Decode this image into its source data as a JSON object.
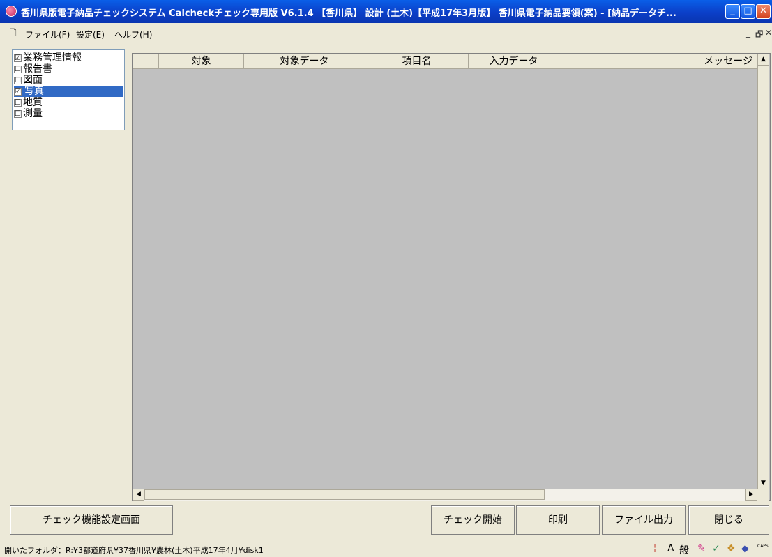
{
  "window": {
    "title": "香川県版電子納品チェックシステム Calcheckチェック専用版 V6.1.4 【香川県】 設計 (土木)【平成17年3月版】 香川県電子納品要領(案) - [納品データチ..."
  },
  "window_controls": {
    "minimize": "_",
    "maximize": "□",
    "close": "✕"
  },
  "menu": {
    "items": [
      "ファイル(F)",
      "設定(E)",
      "ヘルプ(H)"
    ]
  },
  "mdi_controls": {
    "minimize": "_",
    "restore": "🗗",
    "close": "✕"
  },
  "tree": {
    "items": [
      {
        "label": "業務管理情報",
        "checked": "☑"
      },
      {
        "label": "報告書",
        "checked": "☐"
      },
      {
        "label": "図面",
        "checked": "☐"
      },
      {
        "label": "写真",
        "checked": "☑"
      },
      {
        "label": "地質",
        "checked": "☐"
      },
      {
        "label": "測量",
        "checked": "☐"
      }
    ],
    "selected_index": 3
  },
  "grid": {
    "columns": [
      "",
      "対象",
      "対象データ",
      "項目名",
      "入力データ",
      "メッセージ"
    ],
    "rows": []
  },
  "scroll": {
    "up": "▲",
    "down": "▼",
    "left": "◀",
    "right": "▶"
  },
  "buttons": {
    "settings": "チェック機能設定画面",
    "start": "チェック開始",
    "print": "印刷",
    "export": "ファイル出力",
    "close": "閉じる"
  },
  "status": {
    "text": "開いたフォルダ：R:¥3都道府県¥37香川県¥農林(土木)平成17年4月¥disk1",
    "ime_a": "A",
    "ime_mode": "般",
    "caps": "CAPS"
  },
  "colors": {
    "titlebar": "#0b3fc8",
    "selection": "#316ac5",
    "grid_bg": "#c0c0c0",
    "face": "#ece9d8"
  }
}
